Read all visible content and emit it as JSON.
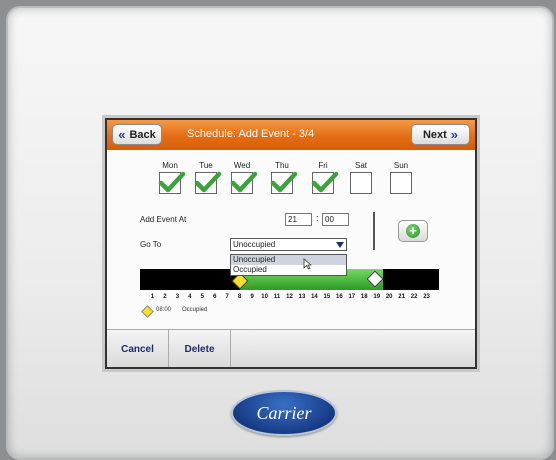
{
  "header": {
    "back_label": "Back",
    "title": "Schedule: Add Event - 3/4",
    "next_label": "Next"
  },
  "days": [
    {
      "label": "Mon",
      "checked": true
    },
    {
      "label": "Tue",
      "checked": true
    },
    {
      "label": "Wed",
      "checked": true
    },
    {
      "label": "Thu",
      "checked": true
    },
    {
      "label": "Fri",
      "checked": true
    },
    {
      "label": "Sat",
      "checked": false
    },
    {
      "label": "Sun",
      "checked": false
    }
  ],
  "form": {
    "add_event_at_label": "Add Event At",
    "hour_value": "21",
    "minute_value": "00",
    "time_separator": ":",
    "go_to_label": "Go To",
    "go_to_value": "Unoccupied",
    "options": [
      "Unoccupied",
      "Occupied"
    ],
    "add_button_icon": "plus-icon"
  },
  "timeline": {
    "hours": [
      "1",
      "2",
      "3",
      "4",
      "5",
      "6",
      "7",
      "8",
      "9",
      "10",
      "11",
      "12",
      "13",
      "14",
      "15",
      "16",
      "17",
      "18",
      "19",
      "20",
      "21",
      "22",
      "23"
    ],
    "occupied_start_hour": 8,
    "occupied_end_hour": 19.5,
    "colors": {
      "occupied": "#3bb02f",
      "unoccupied": "#000000",
      "start_marker": "#f6df25",
      "end_marker": "#ffffff"
    }
  },
  "legend": {
    "time": "08:00",
    "mode": "Occupied"
  },
  "footer": {
    "cancel_label": "Cancel",
    "delete_label": "Delete"
  },
  "brand": {
    "logo_text": "Carrier"
  },
  "colors": {
    "title_bar": "#e46d14",
    "check": "#3aa33b"
  }
}
